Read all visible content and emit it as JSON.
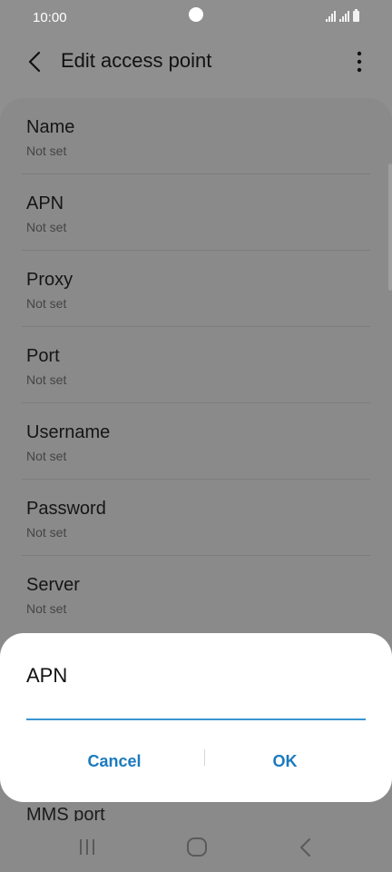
{
  "status_bar": {
    "time": "10:00"
  },
  "app_bar": {
    "title": "Edit access point"
  },
  "list": {
    "items": [
      {
        "label": "Name",
        "value": "Not set"
      },
      {
        "label": "APN",
        "value": "Not set"
      },
      {
        "label": "Proxy",
        "value": "Not set"
      },
      {
        "label": "Port",
        "value": "Not set"
      },
      {
        "label": "Username",
        "value": "Not set"
      },
      {
        "label": "Password",
        "value": "Not set"
      },
      {
        "label": "Server",
        "value": "Not set"
      }
    ],
    "peek_label": "MMS port"
  },
  "dialog": {
    "title": "APN",
    "input_value": "",
    "cancel_label": "Cancel",
    "ok_label": "OK"
  },
  "colors": {
    "accent": "#1c7abf",
    "input_underline": "#3a96d1",
    "scrim": "#8f8f8f"
  },
  "icons": {
    "back": "chevron-left-icon",
    "more": "more-vertical-icon",
    "recents": "recents-icon",
    "home": "home-icon",
    "nav_back": "nav-back-icon"
  }
}
